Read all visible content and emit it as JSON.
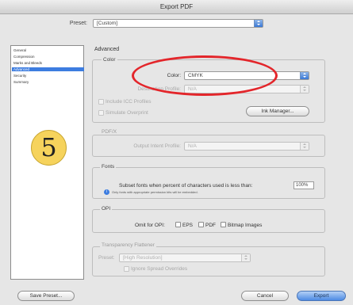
{
  "window": {
    "title": "Export PDF"
  },
  "preset": {
    "label": "Preset:",
    "value": "[Custom]"
  },
  "sidebar": {
    "items": [
      {
        "label": "General"
      },
      {
        "label": "Compression"
      },
      {
        "label": "Marks and Bleeds"
      },
      {
        "label": "Advanced",
        "selected": true
      },
      {
        "label": "Security"
      },
      {
        "label": "Summary"
      }
    ]
  },
  "step_badge": "5",
  "advanced": {
    "title": "Advanced",
    "color_group": {
      "label": "Color",
      "color_label": "Color:",
      "color_value": "CMYK",
      "dest_profile_label": "Destination Profile:",
      "dest_profile_value": "N/A",
      "include_icc_label": "Include ICC Profiles",
      "simulate_overprint_label": "Simulate Overprint",
      "ink_manager_label": "Ink Manager..."
    },
    "pdfx_group": {
      "label": "PDF/X",
      "output_intent_label": "Output Intent Profile:",
      "output_intent_value": "N/A"
    },
    "fonts_group": {
      "label": "Fonts",
      "subset_label": "Subset fonts when percent of characters used is less than:",
      "subset_value": "100%",
      "note": "Only fonts with appropriate permission bits will be embedded."
    },
    "opi_group": {
      "label": "OPI",
      "omit_label": "Omit for OPI:",
      "eps_label": "EPS",
      "pdf_label": "PDF",
      "bitmap_label": "Bitmap Images"
    },
    "transparency_group": {
      "label": "Transparency Flattener",
      "preset_label": "Preset:",
      "preset_value": "[High Resolution]",
      "ignore_label": "Ignore Spread Overrides"
    }
  },
  "footer": {
    "save_preset": "Save Preset...",
    "cancel": "Cancel",
    "export": "Export"
  },
  "colors": {
    "highlight": "#e3262b",
    "selection": "#3d7de0",
    "badge": "#f6d35c"
  }
}
